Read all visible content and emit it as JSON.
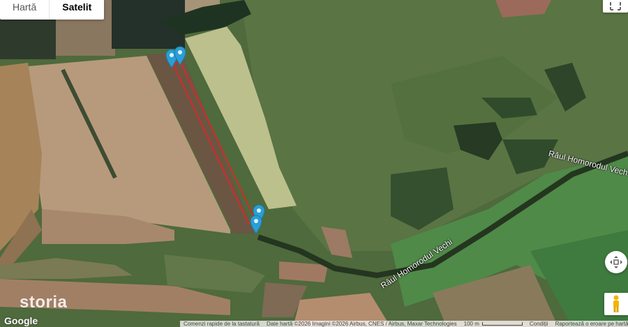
{
  "map_type": {
    "tabs": [
      {
        "label": "Hartă",
        "active": false
      },
      {
        "label": "Satelit",
        "active": true
      }
    ]
  },
  "map": {
    "mode": "satellite",
    "river_labels": [
      "Râul Homorodul Vechi",
      "Râul Homorodul Vechi"
    ],
    "markers": [
      {
        "type": "pin",
        "color": "#2a9fd6"
      },
      {
        "type": "pin",
        "color": "#2a9fd6"
      },
      {
        "type": "pin",
        "color": "#2a9fd6"
      },
      {
        "type": "pin",
        "color": "#2a9fd6"
      }
    ],
    "parcel_outline_color": "#d42a2a"
  },
  "watermark": "storia",
  "google_logo": "Google",
  "attribution": {
    "shortcuts": "Comenzi rapide de la tastatură",
    "map_data": "Date hartă ©2026 Imagini ©2026 Airbus, CNES / Airbus, Maxar Technologies",
    "scale": "100 m",
    "terms": "Condiții",
    "report": "Raportează o eroare pe hartă"
  },
  "controls": {
    "fullscreen_icon": "fullscreen-icon",
    "pan_icon": "pan-icon",
    "pegman_icon": "pegman-icon"
  }
}
